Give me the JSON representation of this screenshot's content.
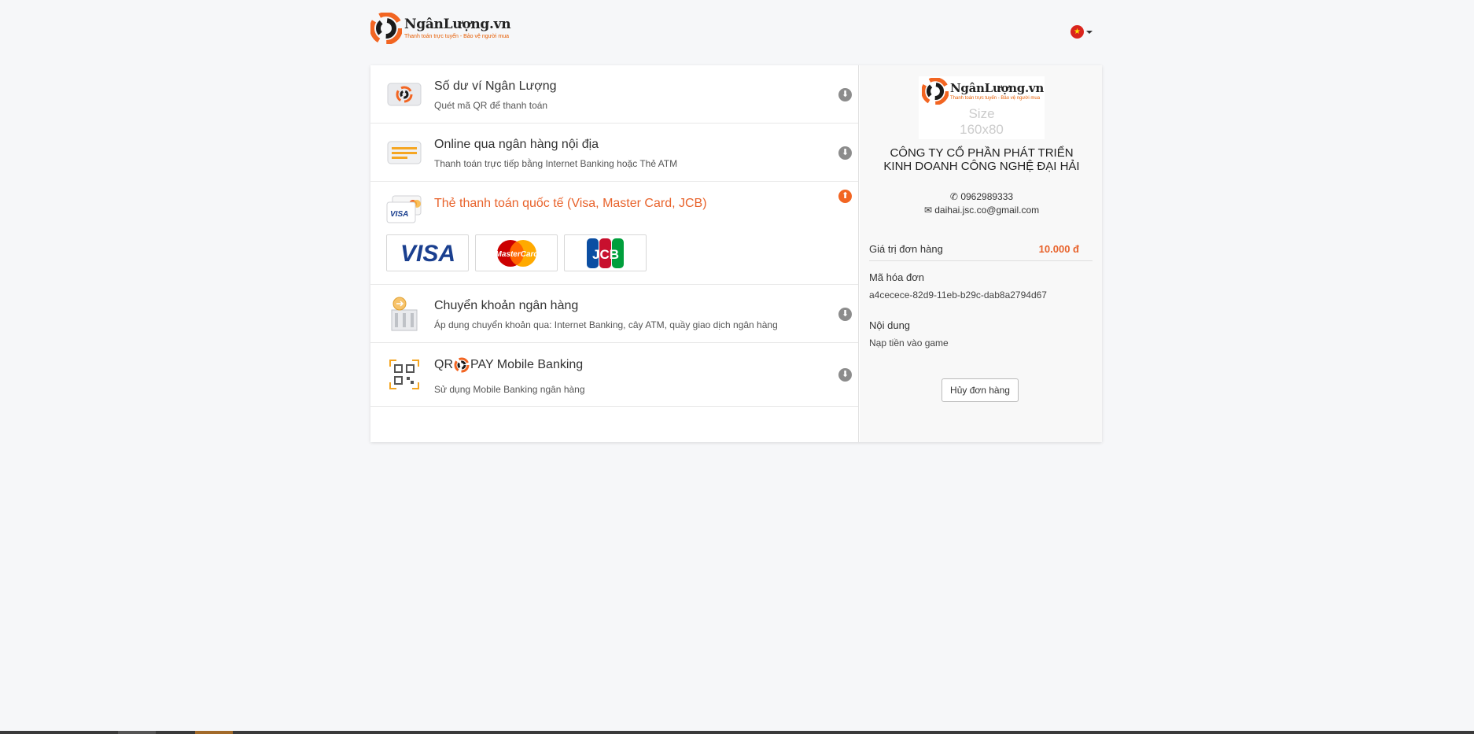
{
  "header": {
    "logo_name": "NgânLượng.vn",
    "logo_slogan": "Thanh toán trực tuyến - Bảo vệ người mua",
    "language_flag": "vietnam-flag-icon"
  },
  "methods": [
    {
      "title": "Số dư ví Ngân Lượng",
      "subtitle": "Quét mã QR để thanh toán",
      "icon": "wallet-icon",
      "toggle": "arrow-circle-down-icon"
    },
    {
      "title": "Online qua ngân hàng nội địa",
      "subtitle": "Thanh toán trực tiếp bằng Internet Banking hoặc Thẻ ATM",
      "icon": "atm-card-icon",
      "toggle": "arrow-circle-down-icon"
    },
    {
      "title": "Thẻ thanh toán quốc tế (Visa, Master Card, JCB)",
      "subtitle": "",
      "icon": "visa-card-icon",
      "toggle": "arrow-circle-up-icon",
      "cards": [
        {
          "name": "VISA",
          "label": "VISA"
        },
        {
          "name": "MasterCard",
          "label": "MasterCard"
        },
        {
          "name": "JCB",
          "label": "JCB"
        }
      ]
    },
    {
      "title": "Chuyển khoản ngân hàng",
      "subtitle": "Áp dụng chuyển khoản qua: Internet Banking, cây ATM, quầy giao dịch ngân hàng",
      "icon": "bank-transfer-icon",
      "toggle": "arrow-circle-down-icon"
    },
    {
      "title_prefix": "QR",
      "title_suffix": "PAY Mobile Banking",
      "subtitle": "Sử dụng Mobile Banking ngân hàng",
      "icon": "qr-code-icon",
      "toggle": "arrow-circle-down-icon"
    }
  ],
  "merchant": {
    "logo_name": "NgânLượng.vn",
    "logo_slogan": "Thanh toán trực tuyến - Bảo vệ người mua",
    "logo_size_line1": "Size",
    "logo_size_line2": "160x80",
    "company": "CÔNG TY CỔ PHẦN PHÁT TRIỂN KINH DOANH CÔNG NGHỆ ĐẠI HẢI",
    "phone": "0962989333",
    "email": "daihai.jsc.co@gmail.com"
  },
  "order": {
    "amount_label": "Giá trị đơn hàng",
    "amount_value": "10.000 đ",
    "invoice_label": "Mã hóa đơn",
    "invoice_value": "a4cecece-82d9-11eb-b29c-dab8a2794d67",
    "content_label": "Nội dung",
    "content_value": "Nạp tiền vào game",
    "cancel_label": "Hủy đơn hàng"
  },
  "colors": {
    "accent": "#e8632c",
    "toggle_inactive": "#8c8c8c"
  }
}
